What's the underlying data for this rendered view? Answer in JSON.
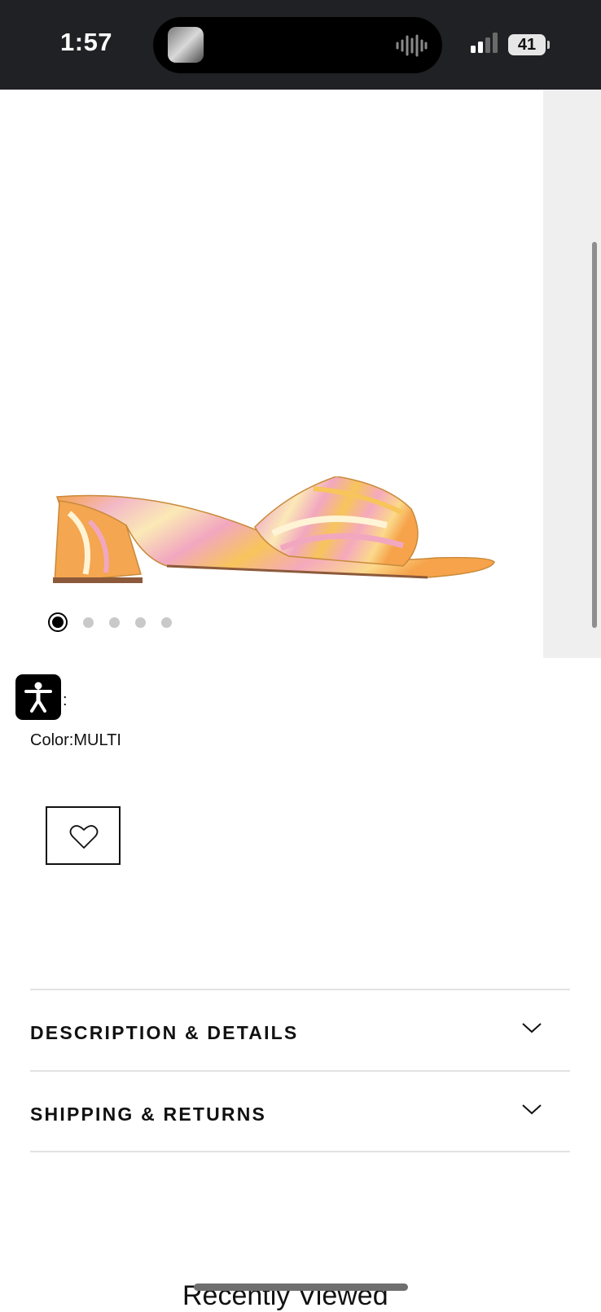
{
  "status_bar": {
    "time": "1:57",
    "battery": "41"
  },
  "gallery": {
    "image_alt": "multicolor patent block heel slide sandal",
    "dots_total": 5,
    "active_dot": 1
  },
  "product": {
    "colon_label": ":",
    "color_label": "Color:",
    "color_value": "MULTI"
  },
  "accordions": [
    {
      "label": "DESCRIPTION & DETAILS"
    },
    {
      "label": "SHIPPING & RETURNS"
    }
  ],
  "recently_viewed": {
    "title": "Recently Viewed"
  },
  "colors": {
    "status_bar_bg": "#202124",
    "accent": "#111111"
  }
}
